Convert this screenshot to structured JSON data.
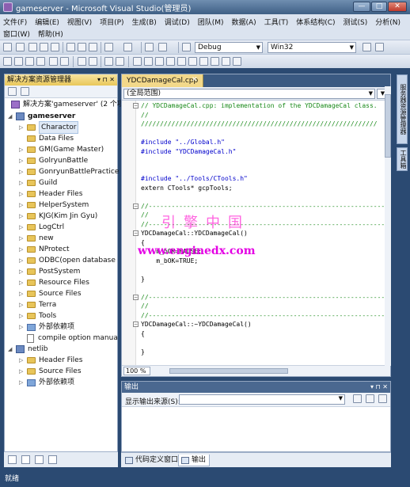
{
  "window": {
    "title": "gameserver - Microsoft Visual Studio(管理员)",
    "controls": {
      "minimize": "—",
      "maximize": "□",
      "close": "✕"
    }
  },
  "menu": {
    "row1": [
      "文件(F)",
      "编辑(E)",
      "视图(V)",
      "项目(P)",
      "生成(B)",
      "调试(D)",
      "团队(M)",
      "数据(A)",
      "工具(T)",
      "体系结构(C)",
      "测试(S)",
      "分析(N)"
    ],
    "row2": [
      "窗口(W)",
      "帮助(H)"
    ]
  },
  "toolbar": {
    "config": "Debug",
    "platform": "Win32"
  },
  "solution_explorer": {
    "title": "解决方案资源管理器",
    "header_controls": "▾ ⊓ ✕",
    "solution_label": "解决方案'gameserver' (2 个项",
    "items": [
      {
        "label": "gameserver",
        "bold": true,
        "icon": "project-icon",
        "expand": "◢"
      },
      {
        "label": "Charactor",
        "icon": "folder-icon",
        "expand": "▷",
        "selected": true
      },
      {
        "label": "Data Files",
        "icon": "folder-icon",
        "expand": ""
      },
      {
        "label": "GM(Game Master)",
        "icon": "folder-icon",
        "expand": "▷"
      },
      {
        "label": "GolryunBattle",
        "icon": "folder-icon",
        "expand": "▷"
      },
      {
        "label": "GonryunBattlePractice",
        "icon": "folder-icon",
        "expand": "▷"
      },
      {
        "label": "Guild",
        "icon": "folder-icon",
        "expand": "▷"
      },
      {
        "label": "Header Files",
        "icon": "folder-icon",
        "expand": "▷"
      },
      {
        "label": "HelperSystem",
        "icon": "folder-icon",
        "expand": "▷"
      },
      {
        "label": "KJG(Kim Jin Gyu)",
        "icon": "folder-icon",
        "expand": "▷"
      },
      {
        "label": "LogCtrl",
        "icon": "folder-icon",
        "expand": "▷"
      },
      {
        "label": "new",
        "icon": "folder-icon",
        "expand": "▷"
      },
      {
        "label": "NProtect",
        "icon": "folder-icon",
        "expand": "▷"
      },
      {
        "label": "ODBC(open database",
        "icon": "folder-icon",
        "expand": "▷"
      },
      {
        "label": "PostSystem",
        "icon": "folder-icon",
        "expand": "▷"
      },
      {
        "label": "Resource Files",
        "icon": "folder-icon",
        "expand": "▷"
      },
      {
        "label": "Source Files",
        "icon": "folder-icon",
        "expand": "▷"
      },
      {
        "label": "Terra",
        "icon": "folder-icon",
        "expand": "▷"
      },
      {
        "label": "Tools",
        "icon": "folder-icon",
        "expand": "▷"
      },
      {
        "label": "外部依赖项",
        "icon": "reference-icon",
        "expand": "▷"
      },
      {
        "label": "compile option manua",
        "icon": "file-icon",
        "expand": ""
      },
      {
        "label": "netlib",
        "bold": false,
        "icon": "project-icon",
        "expand": "◢"
      },
      {
        "label": "Header Files",
        "icon": "folder-icon",
        "expand": "▷"
      },
      {
        "label": "Source Files",
        "icon": "folder-icon",
        "expand": "▷"
      },
      {
        "label": "外部依赖项",
        "icon": "reference-icon",
        "expand": "▷"
      }
    ]
  },
  "editor": {
    "tab_label": "YDCDamageCal.cpp",
    "tab_close": "✕",
    "scope": "(全局范围)",
    "zoom": "100 %",
    "code_lines": [
      {
        "text": "// YDCDamageCal.cpp: implementation of the YDCDamageCal class.",
        "kind": "cm",
        "fold": "−"
      },
      {
        "text": "//",
        "kind": "cm"
      },
      {
        "text": "//////////////////////////////////////////////////////////////",
        "kind": "cm"
      },
      {
        "text": "",
        "kind": ""
      },
      {
        "text": "#include \"../Global.h\"",
        "kind": "inc"
      },
      {
        "text": "#include \"YDCDamageCal.h\"",
        "kind": "inc"
      },
      {
        "text": "",
        "kind": ""
      },
      {
        "text": "",
        "kind": ""
      },
      {
        "text": "#include \"../Tools/CTools.h\"",
        "kind": "inc"
      },
      {
        "text": "extern CTools* gcpTools;",
        "kind": "plain"
      },
      {
        "text": "",
        "kind": ""
      },
      {
        "text": "//--------------------------------------------------------------",
        "kind": "cm",
        "fold": "−"
      },
      {
        "text": "//",
        "kind": "cm"
      },
      {
        "text": "//--------------------------------------------------------------",
        "kind": "cm"
      },
      {
        "text": "YDCDamageCal::YDCDamageCal()",
        "kind": "plain",
        "fold": "−"
      },
      {
        "text": "{",
        "kind": "plain"
      },
      {
        "text": "    m_bOK=FALSE;",
        "kind": "plain"
      },
      {
        "text": "    m_bOK=TRUE;",
        "kind": "plain"
      },
      {
        "text": "",
        "kind": ""
      },
      {
        "text": "}",
        "kind": "plain"
      },
      {
        "text": "",
        "kind": ""
      },
      {
        "text": "//--------------------------------------------------------------",
        "kind": "cm",
        "fold": "−"
      },
      {
        "text": "//",
        "kind": "cm"
      },
      {
        "text": "//--------------------------------------------------------------",
        "kind": "cm"
      },
      {
        "text": "YDCDamageCal::~YDCDamageCal()",
        "kind": "plain",
        "fold": "−"
      },
      {
        "text": "{",
        "kind": "plain"
      },
      {
        "text": "",
        "kind": ""
      },
      {
        "text": "}",
        "kind": "plain"
      }
    ],
    "watermark_cn": "引擎中国",
    "watermark_url": "www.enginedx.com"
  },
  "output": {
    "title": "输出",
    "header_controls": "▾ ⊓ ✕",
    "source_label": "显示输出来源(S):"
  },
  "bottom_tabs": {
    "code_def": "代码定义窗口",
    "output": "输出"
  },
  "right_strip": {
    "tab1": "服务器资源管理器",
    "tab2": "工具箱"
  },
  "status": {
    "text": "就绪"
  }
}
